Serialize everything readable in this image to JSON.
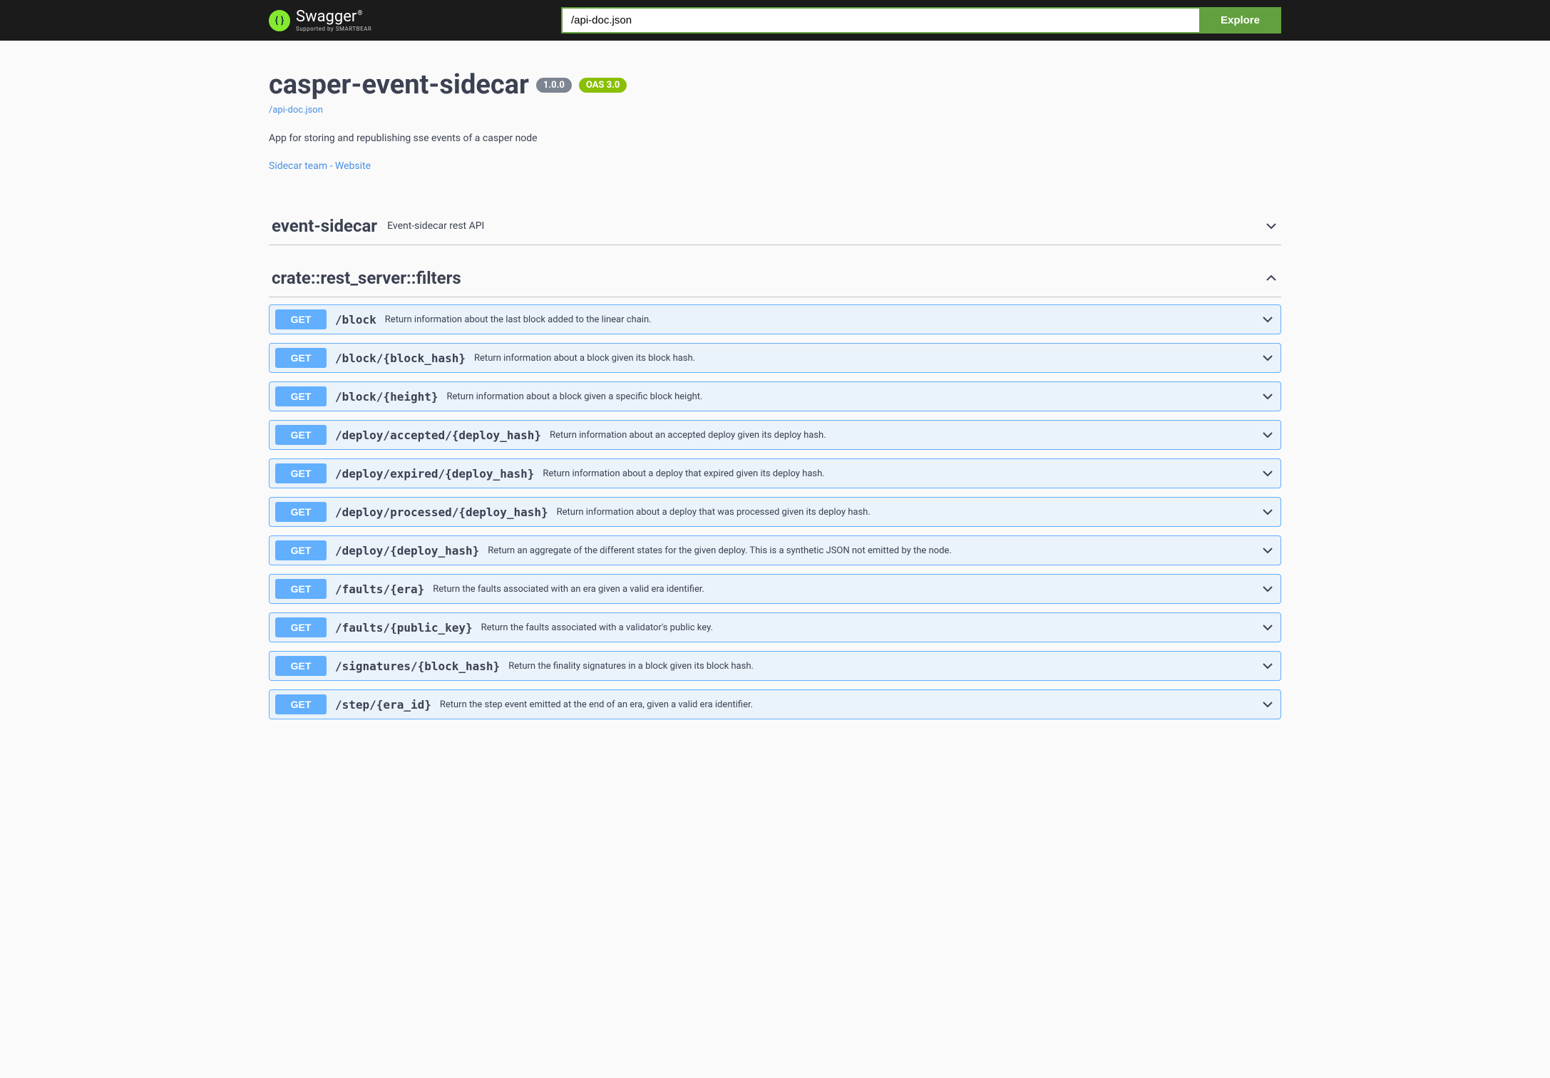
{
  "topbar": {
    "logo_main": "Swagger",
    "logo_supported": "Supported by SMARTBEAR",
    "search_value": "/api-doc.json",
    "explore_label": "Explore"
  },
  "info": {
    "title": "casper-event-sidecar",
    "version": "1.0.0",
    "oas": "OAS 3.0",
    "spec_url_text": "/api-doc.json",
    "description": "App for storing and republishing sse events of a casper node",
    "contact_text": "Sidecar team - Website"
  },
  "tags": [
    {
      "name": "event-sidecar",
      "description": "Event-sidecar rest API",
      "expanded": false
    },
    {
      "name": "crate::rest_server::filters",
      "description": "",
      "expanded": true,
      "operations": [
        {
          "method": "GET",
          "path": "/block",
          "summary": "Return information about the last block added to the linear chain."
        },
        {
          "method": "GET",
          "path": "/block/{block_hash}",
          "summary": "Return information about a block given its block hash."
        },
        {
          "method": "GET",
          "path": "/block/{height}",
          "summary": "Return information about a block given a specific block height."
        },
        {
          "method": "GET",
          "path": "/deploy/accepted/{deploy_hash}",
          "summary": "Return information about an accepted deploy given its deploy hash."
        },
        {
          "method": "GET",
          "path": "/deploy/expired/{deploy_hash}",
          "summary": "Return information about a deploy that expired given its deploy hash."
        },
        {
          "method": "GET",
          "path": "/deploy/processed/{deploy_hash}",
          "summary": "Return information about a deploy that was processed given its deploy hash."
        },
        {
          "method": "GET",
          "path": "/deploy/{deploy_hash}",
          "summary": "Return an aggregate of the different states for the given deploy. This is a synthetic JSON not emitted by the node."
        },
        {
          "method": "GET",
          "path": "/faults/{era}",
          "summary": "Return the faults associated with an era given a valid era identifier."
        },
        {
          "method": "GET",
          "path": "/faults/{public_key}",
          "summary": "Return the faults associated with a validator's public key."
        },
        {
          "method": "GET",
          "path": "/signatures/{block_hash}",
          "summary": "Return the finality signatures in a block given its block hash."
        },
        {
          "method": "GET",
          "path": "/step/{era_id}",
          "summary": "Return the step event emitted at the end of an era, given a valid era identifier."
        }
      ]
    }
  ]
}
